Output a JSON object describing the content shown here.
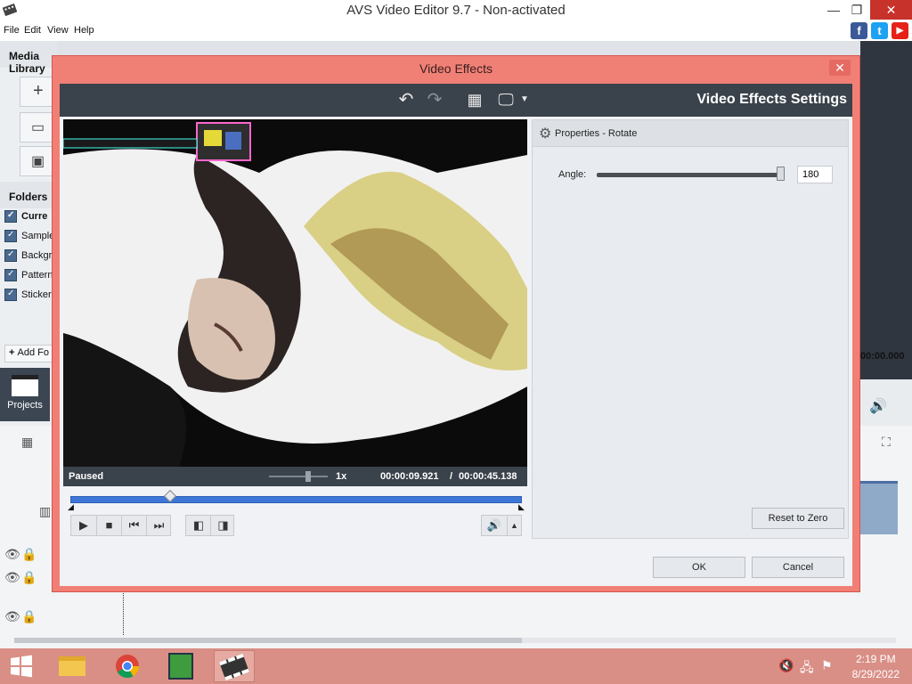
{
  "window": {
    "title": "AVS Video Editor 9.7 - Non-activated",
    "minimize": "—",
    "restore": "❐",
    "close": "✕"
  },
  "menu": {
    "file": "File",
    "edit": "Edit",
    "view": "View",
    "help": "Help"
  },
  "social": {
    "facebook": "f",
    "twitter": "t",
    "youtube": "▶"
  },
  "left_panel": {
    "media_library": "Media Library",
    "folders": "Folders",
    "folder_items": [
      "Curre",
      "Sample",
      "Backgr",
      "Pattern",
      "Sticker"
    ],
    "add_folder": "Add Fo",
    "projects": "Projects"
  },
  "right_panel": {
    "timecode": "00:00.000"
  },
  "dialog": {
    "title": "Video Effects",
    "close": "✕",
    "settings_title": "Video Effects Settings",
    "status": "Paused",
    "speed": "1x",
    "time_current": "00:00:09.921",
    "time_separator": "/",
    "time_total": "00:00:45.138",
    "properties_title": "Properties - Rotate",
    "angle_label": "Angle:",
    "angle_value": "180",
    "angle_fraction": 0.98,
    "seek_fraction": 0.22,
    "reset_button": "Reset to Zero",
    "ok_button": "OK",
    "cancel_button": "Cancel"
  },
  "taskbar": {
    "time": "2:19 PM",
    "date": "8/29/2022"
  }
}
